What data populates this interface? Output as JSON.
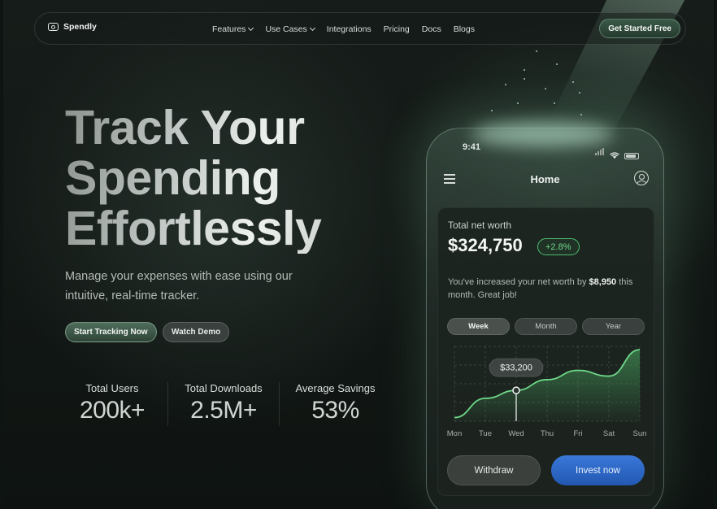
{
  "brand": {
    "name": "Spendly",
    "icon": "wallet-icon"
  },
  "nav": {
    "links": [
      {
        "label": "Features",
        "dropdown": true
      },
      {
        "label": "Use Cases",
        "dropdown": true
      },
      {
        "label": "Integrations",
        "dropdown": false
      },
      {
        "label": "Pricing",
        "dropdown": false
      },
      {
        "label": "Docs",
        "dropdown": false
      },
      {
        "label": "Blogs",
        "dropdown": false
      }
    ],
    "cta": "Get Started Free"
  },
  "hero": {
    "title_lines": [
      "Track Your",
      "Spending",
      "Effortlessly"
    ],
    "subtitle": "Manage your expenses with ease using our intuitive, real-time tracker.",
    "primary_button": "Start Tracking Now",
    "secondary_button": "Watch Demo"
  },
  "stats": [
    {
      "label": "Total Users",
      "value": "200k+"
    },
    {
      "label": "Total Downloads",
      "value": "2.5M+"
    },
    {
      "label": "Average Savings",
      "value": "53%"
    }
  ],
  "phone": {
    "status_time": "9:41",
    "screen_title": "Home",
    "net_worth_label": "Total net worth",
    "net_worth_value": "$324,750",
    "change_badge": "+2.8%",
    "message_prefix": "You've increased your net worth by ",
    "message_amount": "$8,950",
    "message_suffix": " this month. Great job!",
    "periods": [
      {
        "label": "Week",
        "active": true
      },
      {
        "label": "Month",
        "active": false
      },
      {
        "label": "Year",
        "active": false
      }
    ],
    "tooltip": "$33,200",
    "withdraw_label": "Withdraw",
    "invest_label": "Invest now"
  },
  "chart_data": {
    "type": "area",
    "categories": [
      "Mon",
      "Tue",
      "Wed",
      "Thu",
      "Fri",
      "Sat",
      "Sun"
    ],
    "values": [
      0.05,
      0.32,
      0.43,
      0.58,
      0.71,
      0.63,
      1.0
    ],
    "highlight_index": 2,
    "highlight_label": "$33,200",
    "grid": true,
    "colors": {
      "line": "#6fd98a",
      "fill": "#3f8a52"
    }
  },
  "colors": {
    "accent_green": "#6fd98a",
    "invest_blue": "#2e6cc9"
  }
}
